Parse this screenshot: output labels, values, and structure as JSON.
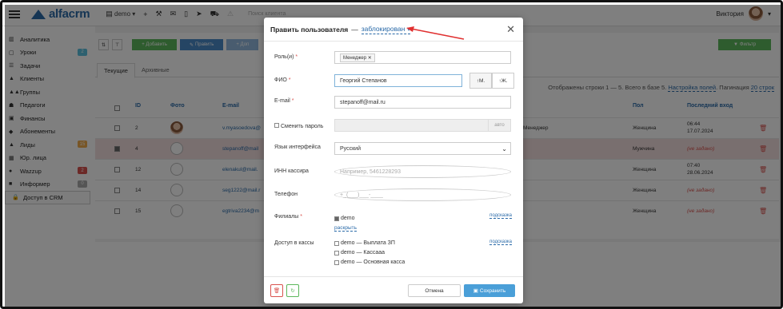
{
  "topbar": {
    "brand": "alfacrm",
    "branch": "demo",
    "search_placeholder": "Поиск клиента",
    "user_name": "Виктория"
  },
  "sidebar": {
    "items": [
      {
        "label": "Аналитика",
        "icon": "chart-icon"
      },
      {
        "label": "Уроки",
        "icon": "lessons-icon",
        "badge": "2",
        "badge_color": "#5bc0de"
      },
      {
        "label": "Задачи",
        "icon": "tasks-icon"
      },
      {
        "label": "Клиенты",
        "icon": "client-icon"
      },
      {
        "label": "Группы",
        "icon": "groups-icon"
      },
      {
        "label": "Педагоги",
        "icon": "teacher-icon"
      },
      {
        "label": "Финансы",
        "icon": "finance-icon"
      },
      {
        "label": "Абонементы",
        "icon": "subscription-icon"
      },
      {
        "label": "Лиды",
        "icon": "leads-icon",
        "badge": "15",
        "badge_color": "#f0ad4e"
      },
      {
        "label": "Юр. лица",
        "icon": "company-icon"
      },
      {
        "label": "Wazzup",
        "icon": "chat-icon",
        "badge": "2",
        "badge_color": "#d9534f"
      },
      {
        "label": "Информер",
        "icon": "informer-icon",
        "badge": "0",
        "badge_color": "#aaa"
      },
      {
        "label": "Доступ в CRM",
        "icon": "lock-icon"
      }
    ]
  },
  "toolbar": {
    "add_label": "+ Добавить",
    "edit_label": "Править",
    "more_label": "+ Доп",
    "filter_label": "Фильтр"
  },
  "tabs": {
    "current": "Текущие",
    "archived": "Архивные"
  },
  "summary": {
    "text": "Отображены строки 1 — 5. Всего в базе 5.",
    "settings_link": "Настройка полей",
    "pagination": "Пагинация",
    "per_page": "20 строк"
  },
  "table": {
    "headers": {
      "id": "ID",
      "photo": "Фото",
      "email": "E-mail",
      "gender": "Пол",
      "last_login": "Последний вход"
    },
    "rows": [
      {
        "id": "2",
        "email": "v.myasoedova@",
        "role": "Менеджер",
        "gender": "Женщина",
        "login": "06:44",
        "login_date": "17.07.2024",
        "selected": false,
        "photo": "real"
      },
      {
        "id": "4",
        "email": "stepanoff@mail",
        "role": "",
        "gender": "Мужчина",
        "login": "(не задано)",
        "login_date": "",
        "selected": true,
        "photo": "generic"
      },
      {
        "id": "12",
        "email": "elenakul@mail.",
        "role": "",
        "gender": "Женщина",
        "login": "07:40",
        "login_date": "28.06.2024",
        "selected": false,
        "photo": "generic"
      },
      {
        "id": "14",
        "email": "seg1222@mail.r",
        "role": "",
        "gender": "Женщина",
        "login": "(не задано)",
        "login_date": "",
        "selected": false,
        "photo": "generic"
      },
      {
        "id": "15",
        "email": "egtriva2234@m",
        "role": "",
        "gender": "Женщина",
        "login": "(не задано)",
        "login_date": "",
        "selected": false,
        "photo": "generic"
      }
    ]
  },
  "modal": {
    "title": "Править пользователя",
    "dash": "—",
    "status": "заблокирован",
    "roles_label": "Роль(и)",
    "roles_tag": "Менеджер",
    "fio_label": "ФИО",
    "fio_value": "Георгий Степанов",
    "gender_m": "М.",
    "gender_f": "Ж.",
    "email_label": "E-mail",
    "email_value": "stepanoff@mail.ru",
    "change_password_label": "Сменить пароль",
    "password_suffix": "авто",
    "lang_label": "Язык интерфейса",
    "lang_value": "Русский",
    "inn_label": "ИНН кассира",
    "inn_placeholder": "Например, 5461228293",
    "phone_label": "Телефон",
    "phone_placeholder": "+_(___)___-____",
    "branches_label": "Филиалы",
    "branch_value": "demo",
    "branch_hint": "подсказка",
    "expand_link": "раскрыть",
    "cash_label": "Доступ в кассы",
    "cash_hint": "подсказка",
    "cash_items": [
      "demo — Выплата ЗП",
      "demo — Кассааа",
      "demo — Основная касса"
    ],
    "cancel_label": "Отмена",
    "save_label": "Сохранить"
  },
  "colors": {
    "brand": "#2a6aa8",
    "save_button": "#4a9fd8",
    "danger": "#d9534f",
    "success": "#5cb85c",
    "selected_row": "#f2dede"
  }
}
